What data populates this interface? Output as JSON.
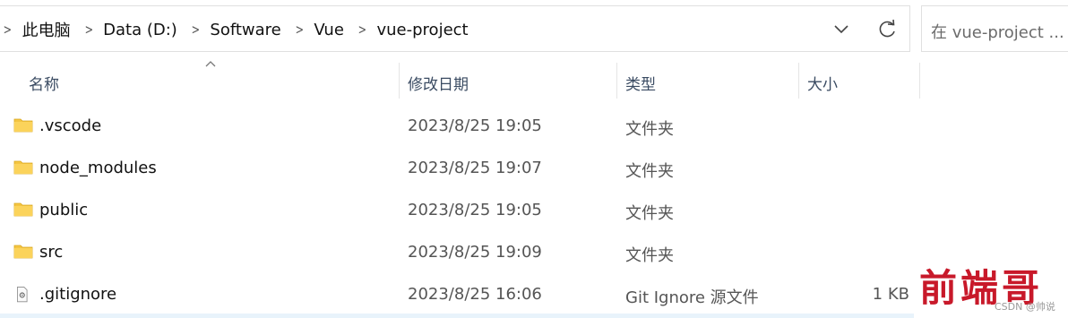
{
  "breadcrumb": [
    "此电脑",
    "Data (D:)",
    "Software",
    "Vue",
    "vue-project"
  ],
  "search": {
    "placeholder": "在 vue-project ..."
  },
  "columns": {
    "name": "名称",
    "modified": "修改日期",
    "type": "类型",
    "size": "大小"
  },
  "files": [
    {
      "name": ".vscode",
      "modified": "2023/8/25 19:05",
      "type": "文件夹",
      "size": "",
      "icon": "folder-icon"
    },
    {
      "name": "node_modules",
      "modified": "2023/8/25 19:07",
      "type": "文件夹",
      "size": "",
      "icon": "folder-icon"
    },
    {
      "name": "public",
      "modified": "2023/8/25 19:05",
      "type": "文件夹",
      "size": "",
      "icon": "folder-icon"
    },
    {
      "name": "src",
      "modified": "2023/8/25 19:09",
      "type": "文件夹",
      "size": "",
      "icon": "folder-icon"
    },
    {
      "name": ".gitignore",
      "modified": "2023/8/25 16:06",
      "type": "Git Ignore 源文件",
      "size": "1 KB",
      "icon": "gear-file-icon"
    }
  ],
  "watermark": {
    "text": "前端哥",
    "credit": "CSDN @帅说"
  },
  "colors": {
    "folder": "#f4c542",
    "header_text": "#3a4b62",
    "watermark": "#c8192a"
  }
}
